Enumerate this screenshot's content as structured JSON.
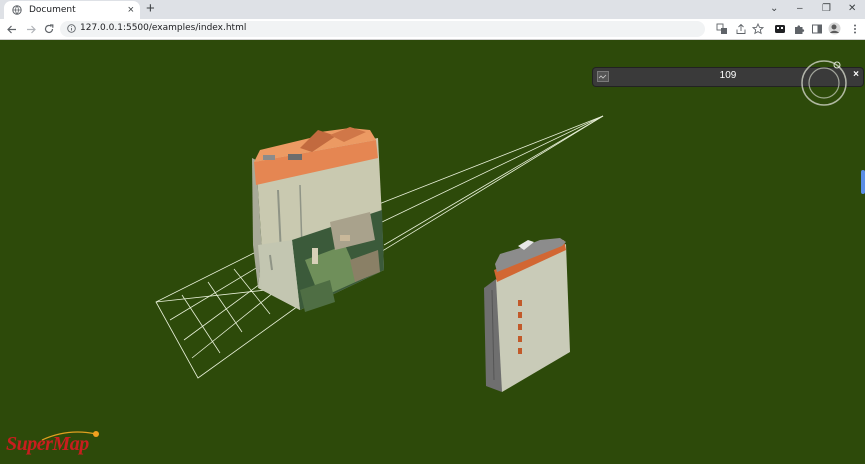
{
  "browser": {
    "tab_title": "Document",
    "tab_close": "×",
    "new_tab": "+",
    "url": "127.0.0.1:5500/examples/index.html",
    "window_controls": {
      "dropdown": "⌄",
      "minimize": "–",
      "restore": "❐",
      "close": "✕"
    }
  },
  "toolbar_icons": [
    "back-icon",
    "forward-icon",
    "reload-icon",
    "site-info-icon",
    "translate-icon",
    "share-icon",
    "bookmark-star-icon",
    "extension-icon",
    "puzzle-icon",
    "side-panel-icon",
    "profile-avatar",
    "menu-icon"
  ],
  "scene": {
    "panel": {
      "value": "109",
      "close": "×"
    },
    "logo": "SuperMap"
  },
  "colors": {
    "ground": "#2d4a0a",
    "panel_bg": "#3a3a3a",
    "logo_red": "#c81e1e",
    "frustum": "#e8f0d8"
  }
}
